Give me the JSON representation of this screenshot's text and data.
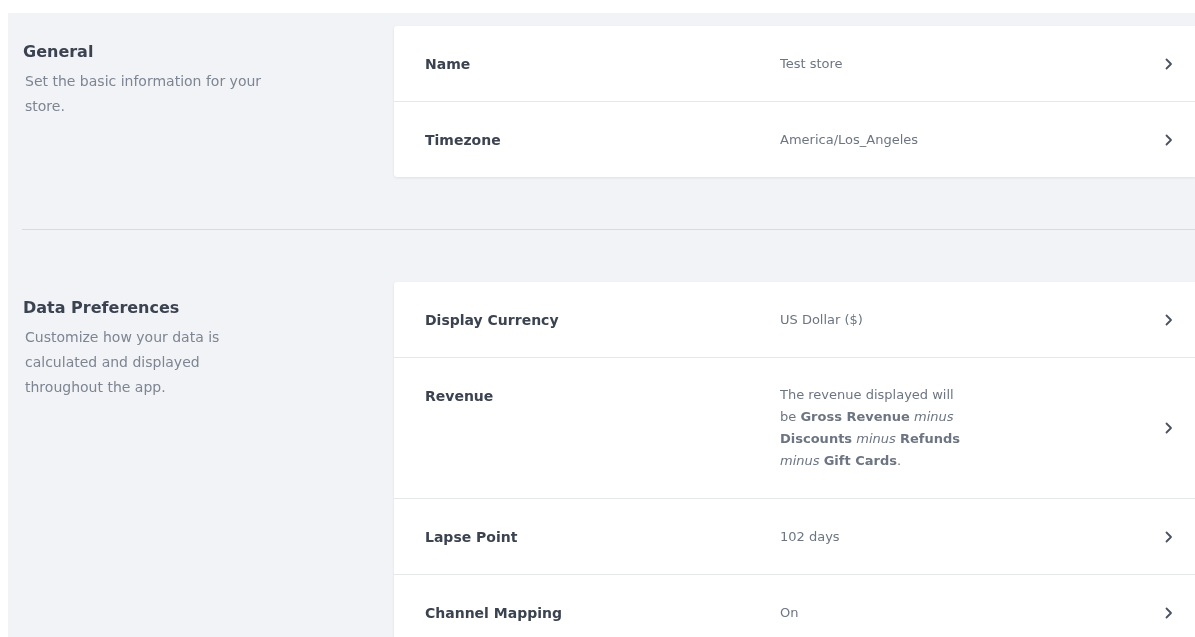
{
  "sections": [
    {
      "title": "General",
      "description": "Set the basic information for your store.",
      "rows": [
        {
          "label": "Name",
          "value": "Test store"
        },
        {
          "label": "Timezone",
          "value": "America/Los_Angeles"
        }
      ]
    },
    {
      "title": "Data Preferences",
      "description": "Customize how your data is calculated and displayed throughout the app.",
      "rows": [
        {
          "label": "Display Currency",
          "value": "US Dollar ($)"
        },
        {
          "label": "Revenue",
          "value": "The revenue displayed will be **Gross Revenue** *minus* **Discounts** *minus* **Refunds** *minus* **Gift Cards**."
        },
        {
          "label": "Lapse Point",
          "value": "102 days"
        },
        {
          "label": "Channel Mapping",
          "value": "On"
        }
      ]
    }
  ]
}
